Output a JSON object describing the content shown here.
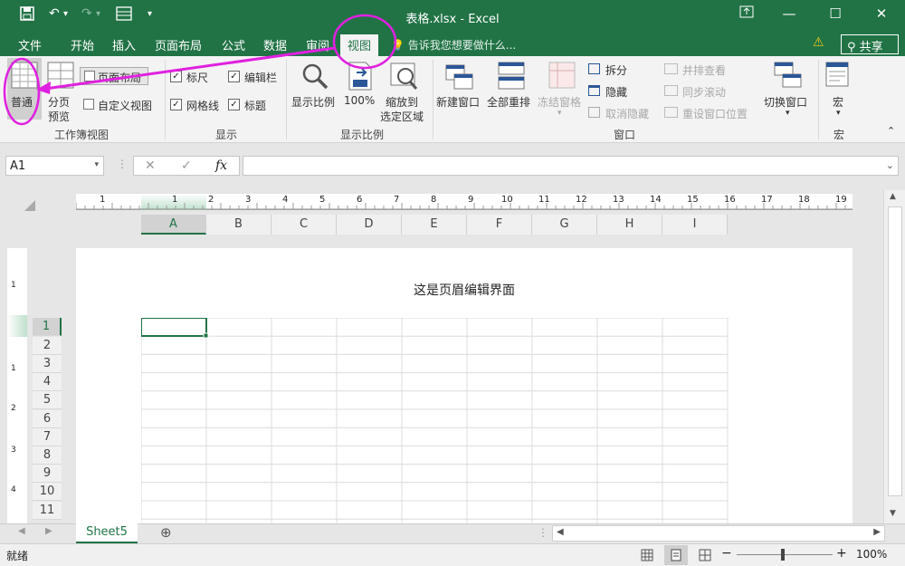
{
  "titlebar": {
    "title": "表格.xlsx - Excel",
    "restore_icon": "restore-icon",
    "min": "—",
    "max": "☐",
    "close": "✕"
  },
  "qat": {
    "undo": "↶",
    "redo": "↷",
    "more": "▾"
  },
  "tabs": [
    "文件",
    "开始",
    "插入",
    "页面布局",
    "公式",
    "数据",
    "审阅",
    "视图"
  ],
  "tell_me": "告诉我您想要做什么...",
  "share_label": "共享",
  "ribbon": {
    "normal": "普通",
    "page_break_1": "分页",
    "page_break_2": "预览",
    "page_layout": "页面布局",
    "custom_view": "自定义视图",
    "group_workbook_views": "工作簿视图",
    "ruler": "标尺",
    "formula_bar": "编辑栏",
    "gridlines": "网格线",
    "headings": "标题",
    "group_show": "显示",
    "zoom": "显示比例",
    "zoom100": "100%",
    "zoom_sel_1": "缩放到",
    "zoom_sel_2": "选定区域",
    "group_zoom": "显示比例",
    "new_window": "新建窗口",
    "arrange_all": "全部重排",
    "freeze": "冻结窗格",
    "split": "拆分",
    "hide": "隐藏",
    "unhide": "取消隐藏",
    "side_by_side": "并排查看",
    "sync_scroll": "同步滚动",
    "reset_pos": "重设窗口位置",
    "group_window": "窗口",
    "switch_window": "切换窗口",
    "macros": "宏",
    "group_macros": "宏"
  },
  "formula": {
    "name_box": "A1",
    "cancel": "✕",
    "enter": "✓",
    "fx": "fx",
    "value": ""
  },
  "ruler_h": [
    "1",
    "1",
    "2",
    "3",
    "4",
    "5",
    "6",
    "7",
    "8",
    "9",
    "10",
    "11",
    "12",
    "13",
    "14",
    "15",
    "16",
    "17",
    "18",
    "19"
  ],
  "columns": [
    "A",
    "B",
    "C",
    "D",
    "E",
    "F",
    "G",
    "H",
    "I"
  ],
  "rows": [
    "1",
    "2",
    "3",
    "4",
    "5",
    "6",
    "7",
    "8",
    "9",
    "10",
    "11"
  ],
  "ruler_v": [
    "1",
    "1",
    "2",
    "3",
    "4"
  ],
  "page_header_text": "这是页眉编辑界面",
  "sheet_tab": "Sheet5",
  "add_sheet": "⊕",
  "status": {
    "ready": "就绪",
    "zoom": "100%",
    "minus": "−",
    "plus": "+"
  },
  "colors": {
    "accent": "#217346",
    "annotation": "#e020e0"
  }
}
